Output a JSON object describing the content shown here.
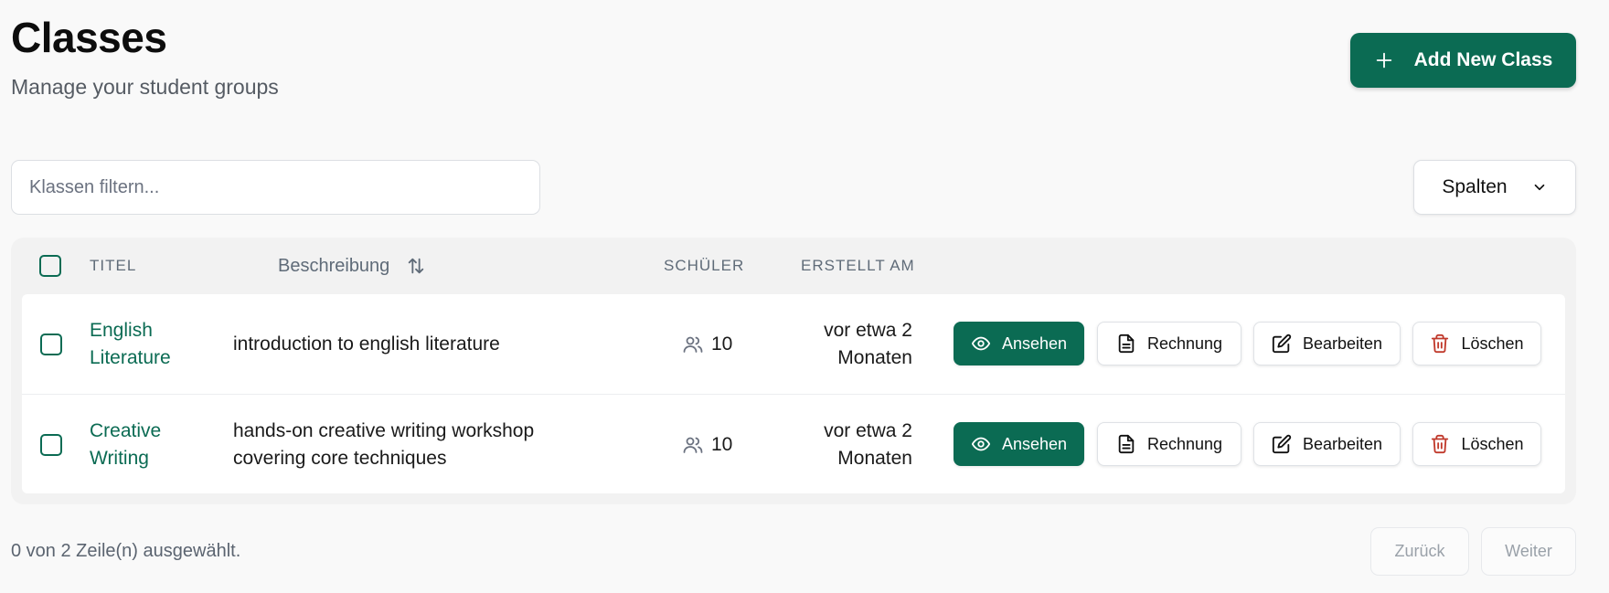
{
  "header": {
    "title": "Classes",
    "subtitle": "Manage your student groups",
    "add_button_label": "Add New Class"
  },
  "toolbar": {
    "filter_placeholder": "Klassen filtern...",
    "filter_value": "",
    "columns_button_label": "Spalten"
  },
  "table": {
    "columns": {
      "title": "TITEL",
      "description": "Beschreibung",
      "students": "SCHÜLER",
      "created": "ERSTELLT AM"
    },
    "rows": [
      {
        "title_line1": "English",
        "title_line2": "Literature",
        "description_line1": "introduction to english literature",
        "description_line2": "",
        "students": "10",
        "created_line1": "vor etwa 2",
        "created_line2": "Monaten",
        "selected": false
      },
      {
        "title_line1": "Creative",
        "title_line2": "Writing",
        "description_line1": "hands-on creative writing workshop",
        "description_line2": "covering core techniques",
        "students": "10",
        "created_line1": "vor etwa 2",
        "created_line2": "Monaten",
        "selected": false
      }
    ],
    "actions": {
      "view": "Ansehen",
      "invoice": "Rechnung",
      "edit": "Bearbeiten",
      "delete": "Löschen"
    }
  },
  "footer": {
    "selection_status": "0 von 2 Zeile(n) ausgewählt.",
    "prev_label": "Zurück",
    "next_label": "Weiter"
  },
  "colors": {
    "primary": "#0b6b53",
    "delete_icon": "#c0392b",
    "muted_text": "#5f6b78",
    "background": "#f9f9f9"
  },
  "icons": {
    "add": "plus-icon",
    "columns": "chevron-down-icon",
    "sort": "sort-arrows-icon",
    "students": "users-icon",
    "view": "eye-icon",
    "invoice": "file-text-icon",
    "edit": "pencil-square-icon",
    "delete": "trash-icon"
  }
}
